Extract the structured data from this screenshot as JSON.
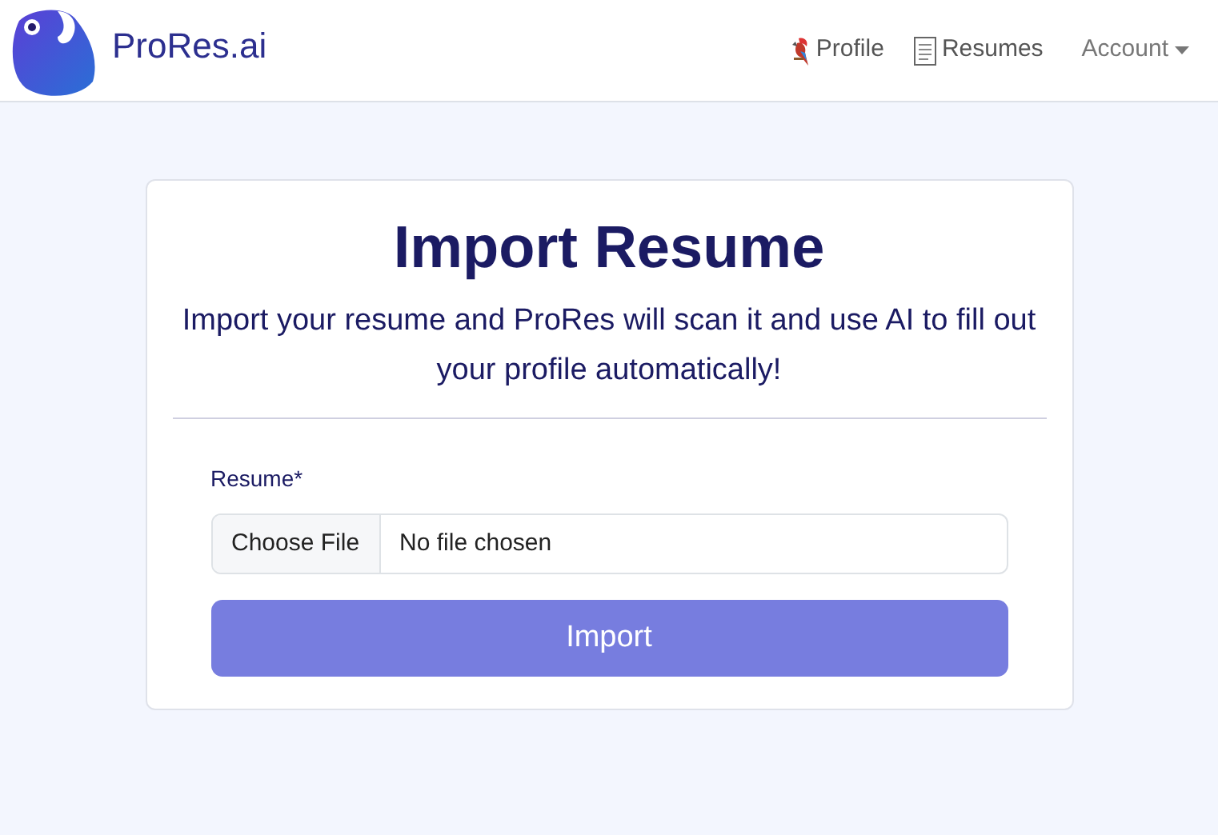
{
  "brand": "ProRes.ai",
  "nav": [
    {
      "label": "Profile",
      "kind": "parrot"
    },
    {
      "label": "Resumes",
      "kind": "page"
    },
    {
      "label": "Account",
      "kind": "dropdown"
    }
  ],
  "card": {
    "title": "Import Resume",
    "description": "Import your resume and ProRes will scan it and use AI to fill out your profile automatically!",
    "field_label": "Resume*",
    "file_button": "Choose File",
    "file_status": "No file chosen",
    "submit": {
      "label": "Import",
      "disabled": true
    }
  }
}
